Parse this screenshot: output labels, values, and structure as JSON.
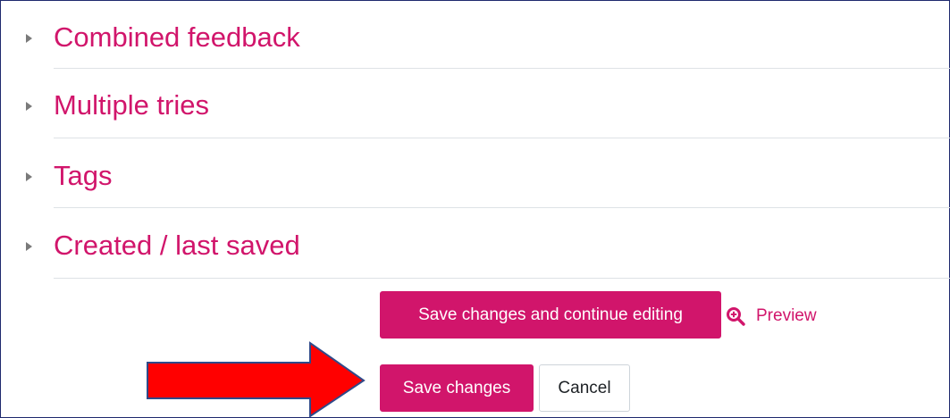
{
  "sections": [
    {
      "title": "Combined feedback"
    },
    {
      "title": "Multiple tries"
    },
    {
      "title": "Tags"
    },
    {
      "title": "Created / last saved"
    }
  ],
  "actions": {
    "save_continue_label": "Save changes and continue editing",
    "preview_label": "Preview",
    "save_label": "Save changes",
    "cancel_label": "Cancel"
  },
  "colors": {
    "accent": "#d1156b",
    "annotation_arrow": "#ff0000",
    "annotation_arrow_outline": "#2f4a8a"
  },
  "icons": {
    "section_toggle": "caret-right-icon",
    "preview": "zoom-in-icon",
    "annotation": "right-arrow-icon"
  }
}
